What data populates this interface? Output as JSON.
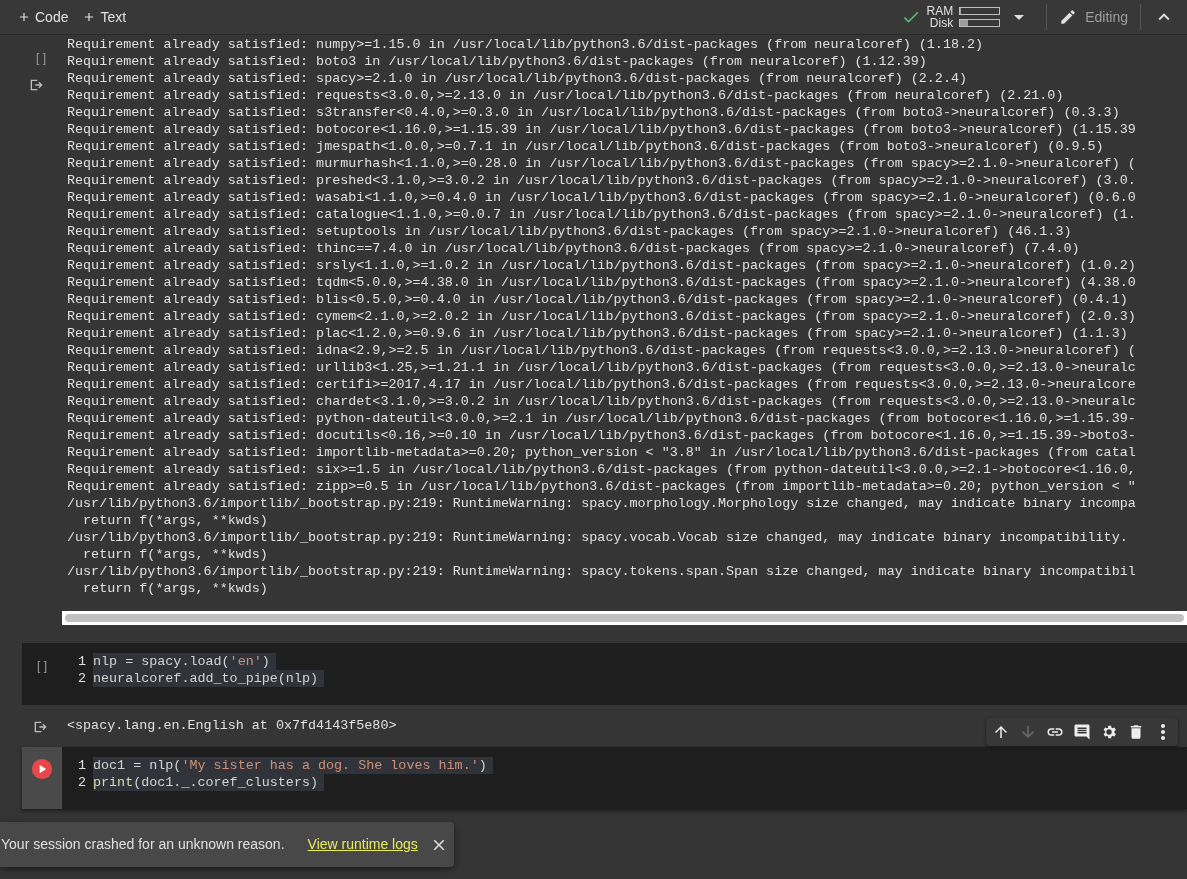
{
  "toolbar": {
    "add_buttons": [
      "Code",
      "Text"
    ],
    "resources": [
      {
        "label": "RAM",
        "level": 0.02
      },
      {
        "label": "Disk",
        "level": 0.2
      }
    ],
    "mode": "Editing"
  },
  "cells": [
    {
      "kind": "output_only",
      "prompt": "[ ]",
      "output": [
        "Requirement already satisfied: numpy>=1.15.0 in /usr/local/lib/python3.6/dist-packages (from neuralcoref) (1.18.2)",
        "Requirement already satisfied: boto3 in /usr/local/lib/python3.6/dist-packages (from neuralcoref) (1.12.39)",
        "Requirement already satisfied: spacy>=2.1.0 in /usr/local/lib/python3.6/dist-packages (from neuralcoref) (2.2.4)",
        "Requirement already satisfied: requests<3.0.0,>=2.13.0 in /usr/local/lib/python3.6/dist-packages (from neuralcoref) (2.21.0)",
        "Requirement already satisfied: s3transfer<0.4.0,>=0.3.0 in /usr/local/lib/python3.6/dist-packages (from boto3->neuralcoref) (0.3.3)",
        "Requirement already satisfied: botocore<1.16.0,>=1.15.39 in /usr/local/lib/python3.6/dist-packages (from boto3->neuralcoref) (1.15.39",
        "Requirement already satisfied: jmespath<1.0.0,>=0.7.1 in /usr/local/lib/python3.6/dist-packages (from boto3->neuralcoref) (0.9.5)",
        "Requirement already satisfied: murmurhash<1.1.0,>=0.28.0 in /usr/local/lib/python3.6/dist-packages (from spacy>=2.1.0->neuralcoref) (",
        "Requirement already satisfied: preshed<3.1.0,>=3.0.2 in /usr/local/lib/python3.6/dist-packages (from spacy>=2.1.0->neuralcoref) (3.0.",
        "Requirement already satisfied: wasabi<1.1.0,>=0.4.0 in /usr/local/lib/python3.6/dist-packages (from spacy>=2.1.0->neuralcoref) (0.6.0",
        "Requirement already satisfied: catalogue<1.1.0,>=0.0.7 in /usr/local/lib/python3.6/dist-packages (from spacy>=2.1.0->neuralcoref) (1.",
        "Requirement already satisfied: setuptools in /usr/local/lib/python3.6/dist-packages (from spacy>=2.1.0->neuralcoref) (46.1.3)",
        "Requirement already satisfied: thinc==7.4.0 in /usr/local/lib/python3.6/dist-packages (from spacy>=2.1.0->neuralcoref) (7.4.0)",
        "Requirement already satisfied: srsly<1.1.0,>=1.0.2 in /usr/local/lib/python3.6/dist-packages (from spacy>=2.1.0->neuralcoref) (1.0.2)",
        "Requirement already satisfied: tqdm<5.0.0,>=4.38.0 in /usr/local/lib/python3.6/dist-packages (from spacy>=2.1.0->neuralcoref) (4.38.0",
        "Requirement already satisfied: blis<0.5.0,>=0.4.0 in /usr/local/lib/python3.6/dist-packages (from spacy>=2.1.0->neuralcoref) (0.4.1)",
        "Requirement already satisfied: cymem<2.1.0,>=2.0.2 in /usr/local/lib/python3.6/dist-packages (from spacy>=2.1.0->neuralcoref) (2.0.3)",
        "Requirement already satisfied: plac<1.2.0,>=0.9.6 in /usr/local/lib/python3.6/dist-packages (from spacy>=2.1.0->neuralcoref) (1.1.3)",
        "Requirement already satisfied: idna<2.9,>=2.5 in /usr/local/lib/python3.6/dist-packages (from requests<3.0.0,>=2.13.0->neuralcoref) (",
        "Requirement already satisfied: urllib3<1.25,>=1.21.1 in /usr/local/lib/python3.6/dist-packages (from requests<3.0.0,>=2.13.0->neuralc",
        "Requirement already satisfied: certifi>=2017.4.17 in /usr/local/lib/python3.6/dist-packages (from requests<3.0.0,>=2.13.0->neuralcore",
        "Requirement already satisfied: chardet<3.1.0,>=3.0.2 in /usr/local/lib/python3.6/dist-packages (from requests<3.0.0,>=2.13.0->neuralc",
        "Requirement already satisfied: python-dateutil<3.0.0,>=2.1 in /usr/local/lib/python3.6/dist-packages (from botocore<1.16.0,>=1.15.39-",
        "Requirement already satisfied: docutils<0.16,>=0.10 in /usr/local/lib/python3.6/dist-packages (from botocore<1.16.0,>=1.15.39->boto3-",
        "Requirement already satisfied: importlib-metadata>=0.20; python_version < \"3.8\" in /usr/local/lib/python3.6/dist-packages (from catal",
        "Requirement already satisfied: six>=1.5 in /usr/local/lib/python3.6/dist-packages (from python-dateutil<3.0.0,>=2.1->botocore<1.16.0,",
        "Requirement already satisfied: zipp>=0.5 in /usr/local/lib/python3.6/dist-packages (from importlib-metadata>=0.20; python_version < \"",
        "/usr/lib/python3.6/importlib/_bootstrap.py:219: RuntimeWarning: spacy.morphology.Morphology size changed, may indicate binary incompa",
        "  return f(*args, **kwds)",
        "/usr/lib/python3.6/importlib/_bootstrap.py:219: RuntimeWarning: spacy.vocab.Vocab size changed, may indicate binary incompatibility.",
        "  return f(*args, **kwds)",
        "/usr/lib/python3.6/importlib/_bootstrap.py:219: RuntimeWarning: spacy.tokens.span.Span size changed, may indicate binary incompatibil",
        "  return f(*args, **kwds)"
      ]
    },
    {
      "kind": "code",
      "prompt": "[ ]",
      "focused": false,
      "lines": [
        {
          "number": "1",
          "tokens": [
            {
              "kind": "plain",
              "text": "nlp = spacy.load("
            },
            {
              "kind": "string",
              "text": "'en'"
            },
            {
              "kind": "plain",
              "text": ")"
            }
          ]
        },
        {
          "number": "2",
          "tokens": [
            {
              "kind": "plain",
              "text": "neuralcoref.add_to_pipe(nlp)"
            }
          ]
        }
      ],
      "output": [
        "<spacy.lang.en.English at 0x7fd4143f5e80>"
      ]
    },
    {
      "kind": "code",
      "focused": true,
      "lines": [
        {
          "number": "1",
          "tokens": [
            {
              "kind": "plain",
              "text": "doc1 = nlp("
            },
            {
              "kind": "string",
              "text": "'My sister has a dog. She loves him.'"
            },
            {
              "kind": "plain",
              "text": ")"
            }
          ]
        },
        {
          "number": "2",
          "tokens": [
            {
              "kind": "builtin",
              "text": "print"
            },
            {
              "kind": "plain",
              "text": "(doc1._.coref_clusters)"
            }
          ]
        }
      ]
    }
  ],
  "cell_toolbar": [
    {
      "kind": "up",
      "disabled": false
    },
    {
      "kind": "down",
      "disabled": true
    },
    {
      "kind": "link",
      "disabled": false
    },
    {
      "kind": "comment",
      "disabled": false
    },
    {
      "kind": "settings",
      "disabled": false
    },
    {
      "kind": "delete",
      "disabled": false
    },
    {
      "kind": "more",
      "disabled": false
    }
  ],
  "toast": {
    "message": "Your session crashed for an unknown reason.",
    "link": "View runtime logs"
  }
}
